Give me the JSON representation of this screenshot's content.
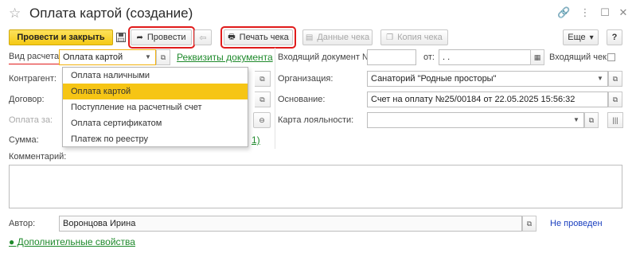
{
  "window": {
    "title": "Оплата картой (создание)"
  },
  "toolbar": {
    "post_close": "Провести и закрыть",
    "post": "Провести",
    "print_check": "Печать чека",
    "check_data": "Данные чека",
    "check_copy": "Копия чека",
    "more": "Еще",
    "help": "?"
  },
  "form": {
    "payment_type_label": "Вид расчета:",
    "payment_type_value": "Оплата картой",
    "requisites_link": "Реквизиты документа",
    "counterparty_label": "Контрагент:",
    "contract_label": "Договор:",
    "pay_for_label": "Оплата за:",
    "sum_label": "Сумма:",
    "sum_link_tail": "1)",
    "incoming_doc_label": "Входящий документ №:",
    "incoming_doc_value": "",
    "from_label": "от:",
    "from_value": ". .",
    "incoming_check_label": "Входящий чек:",
    "organization_label": "Организация:",
    "organization_value": "Санаторий \"Родные просторы\"",
    "basis_label": "Основание:",
    "basis_value": "Счет на оплату №25/00184 от 22.05.2025 15:56:32",
    "loyalty_label": "Карта лояльности:",
    "loyalty_value": "",
    "comment_label": "Комментарий:",
    "comment_value": "",
    "author_label": "Автор:",
    "author_value": "Воронцова Ирина",
    "status": "Не проведен",
    "extra_props": "● Дополнительные свойства"
  },
  "dropdown": {
    "options": [
      "Оплата наличными",
      "Оплата картой",
      "Поступление на расчетный счет",
      "Оплата сертификатом",
      "Платеж по реестру"
    ],
    "selected": "Оплата картой"
  },
  "colors": {
    "accent_yellow": "#f6c515",
    "highlight_red": "#e01b1b",
    "link_green": "#1f8a2c",
    "status_blue": "#1a3fbf"
  }
}
